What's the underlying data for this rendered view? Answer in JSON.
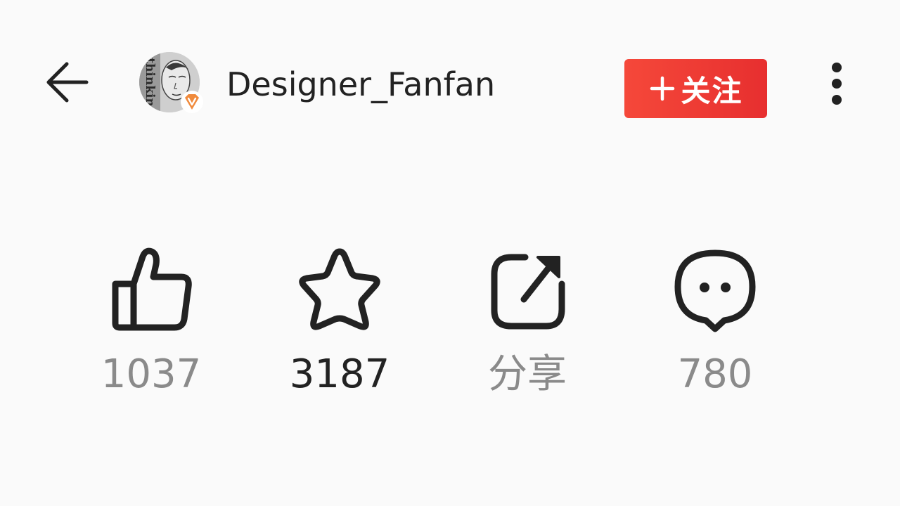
{
  "header": {
    "username": "Designer_Fanfan",
    "follow_label": "关注",
    "avatar_text": "thinkin"
  },
  "actions": [
    {
      "id": "like",
      "icon": "thumbs-up-icon",
      "label": "1037",
      "highlighted": false
    },
    {
      "id": "collect",
      "icon": "star-icon",
      "label": "3187",
      "highlighted": true
    },
    {
      "id": "share",
      "icon": "share-icon",
      "label": "分享",
      "highlighted": false
    },
    {
      "id": "comment",
      "icon": "comment-icon",
      "label": "780",
      "highlighted": false
    }
  ],
  "colors": {
    "background": "#fafafa",
    "follow_button": "#e8342f",
    "icon_stroke": "#222222",
    "muted_text": "#8a8a8a",
    "badge": "#f08a3c"
  }
}
